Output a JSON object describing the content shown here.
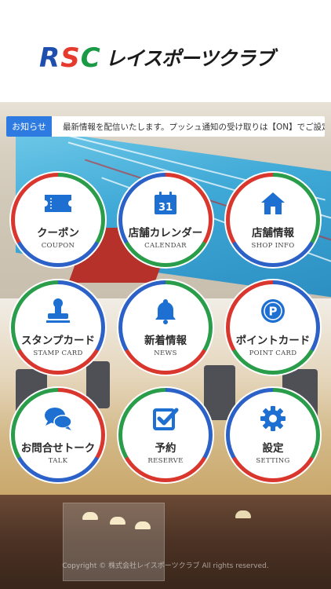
{
  "header": {
    "logo": {
      "letters": [
        "R",
        "S",
        "C"
      ],
      "kana": "レイスポーツクラブ"
    }
  },
  "notice": {
    "badge": "お知らせ",
    "text": "最新情報を配信いたします。プッシュ通知の受け取りは【ON】でご設定ください。"
  },
  "menu": [
    {
      "jp": "クーポン",
      "en": "COUPON",
      "icon": "ticket-icon"
    },
    {
      "jp": "店舗カレンダー",
      "en": "CALENDAR",
      "icon": "calendar-icon",
      "icon_text": "31"
    },
    {
      "jp": "店舗情報",
      "en": "SHOP INFO",
      "icon": "home-icon"
    },
    {
      "jp": "スタンプカード",
      "en": "STAMP CARD",
      "icon": "stamp-icon"
    },
    {
      "jp": "新着情報",
      "en": "NEWS",
      "icon": "bell-icon"
    },
    {
      "jp": "ポイントカード",
      "en": "POINT CARD",
      "icon": "point-coin-icon",
      "icon_text": "P"
    },
    {
      "jp": "お問合せトーク",
      "en": "TALK",
      "icon": "chat-icon"
    },
    {
      "jp": "予約",
      "en": "RESERVE",
      "icon": "checkbox-icon"
    },
    {
      "jp": "設定",
      "en": "SETTING",
      "icon": "gear-icon"
    }
  ],
  "footer": {
    "text": "Copyright © 株式会社レイスポーツクラブ All rights reserved."
  },
  "colors": {
    "icon_blue": "#1d6fd1",
    "ring_red": "#d9372e",
    "ring_green": "#2a9d4a",
    "ring_blue": "#2c61c7",
    "badge_blue": "#2d7be0"
  }
}
